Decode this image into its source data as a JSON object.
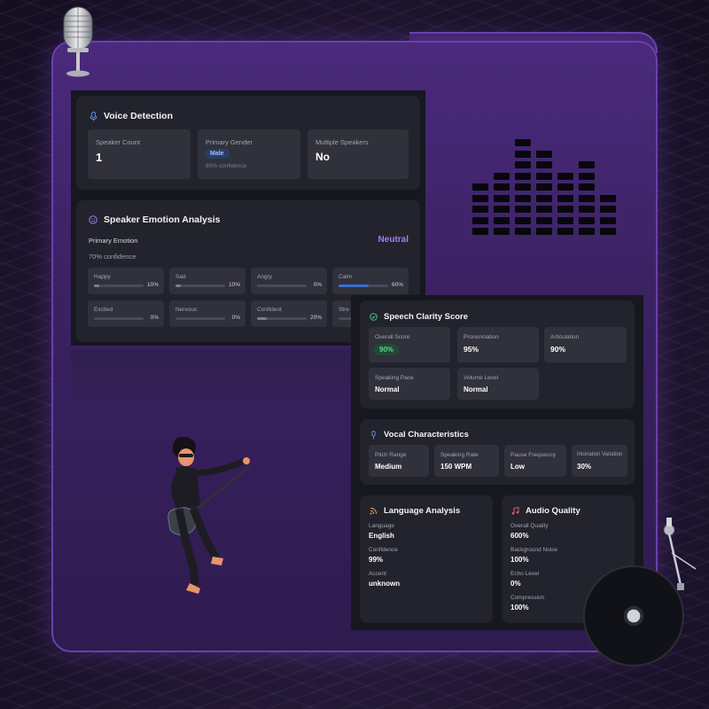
{
  "voice_detection": {
    "title": "Voice Detection",
    "speaker_count_label": "Speaker Count",
    "speaker_count_value": "1",
    "primary_gender_label": "Primary Gender",
    "primary_gender_value": "Male",
    "primary_gender_confidence": "80% confidence",
    "multiple_speakers_label": "Multiple Speakers",
    "multiple_speakers_value": "No"
  },
  "emotion": {
    "title": "Speaker Emotion Analysis",
    "primary_label": "Primary Emotion",
    "primary_value": "Neutral",
    "confidence": "70% confidence",
    "items": [
      {
        "label": "Happy",
        "value": "10%",
        "level": 0.1,
        "color": "#7c7d88"
      },
      {
        "label": "Sad",
        "value": "10%",
        "level": 0.1,
        "color": "#7c7d88"
      },
      {
        "label": "Angry",
        "value": "0%",
        "level": 0.0,
        "color": "#7c7d88"
      },
      {
        "label": "Calm",
        "value": "60%",
        "level": 0.6,
        "color": "#3b6fd1"
      },
      {
        "label": "Excited",
        "value": "0%",
        "level": 0.0,
        "color": "#7c7d88"
      },
      {
        "label": "Nervous",
        "value": "0%",
        "level": 0.0,
        "color": "#7c7d88"
      },
      {
        "label": "Confident",
        "value": "20%",
        "level": 0.2,
        "color": "#7c7d88"
      },
      {
        "label": "Stre",
        "value": "",
        "level": 0.0,
        "color": "#7c7d88"
      }
    ]
  },
  "clarity": {
    "title": "Speech Clarity Score",
    "overall_label": "Overall Score",
    "overall_value": "90%",
    "pronunciation_label": "Pronunciation",
    "pronunciation_value": "95%",
    "articulation_label": "Articulation",
    "articulation_value": "90%",
    "pace_label": "Speaking Pace",
    "pace_value": "Normal",
    "volume_label": "Volume Level",
    "volume_value": "Normal"
  },
  "vocal": {
    "title": "Vocal Characteristics",
    "pitch_label": "Pitch Range",
    "pitch_value": "Medium",
    "rate_label": "Speaking Rate",
    "rate_value": "150 WPM",
    "pause_label": "Pause Frequency",
    "pause_value": "Low",
    "intonation_label": "Intonation Variation",
    "intonation_value": "30%"
  },
  "language": {
    "title": "Language Analysis",
    "language_label": "Language",
    "language_value": "English",
    "confidence_label": "Confidence",
    "confidence_value": "99%",
    "accent_label": "Accent",
    "accent_value": "unknown"
  },
  "audio": {
    "title": "Audio Quality",
    "overall_label": "Overall Quality",
    "overall_value": "600%",
    "noise_label": "Background Noise",
    "noise_value": "100%",
    "echo_label": "Echo Level",
    "echo_value": "0%",
    "compression_label": "Compression",
    "compression_value": "100%"
  },
  "colors": {
    "accent_purple": "#a77bf3",
    "gender_pill": "#2a3d66",
    "score_pill": "#1f4a34",
    "score_text": "#58d68d",
    "calm_bar": "#3b6fd1"
  },
  "icons": [
    "microphone-icon",
    "smiley-icon",
    "check-circle-icon",
    "mic-small-icon",
    "rss-icon",
    "music-note-icon"
  ]
}
